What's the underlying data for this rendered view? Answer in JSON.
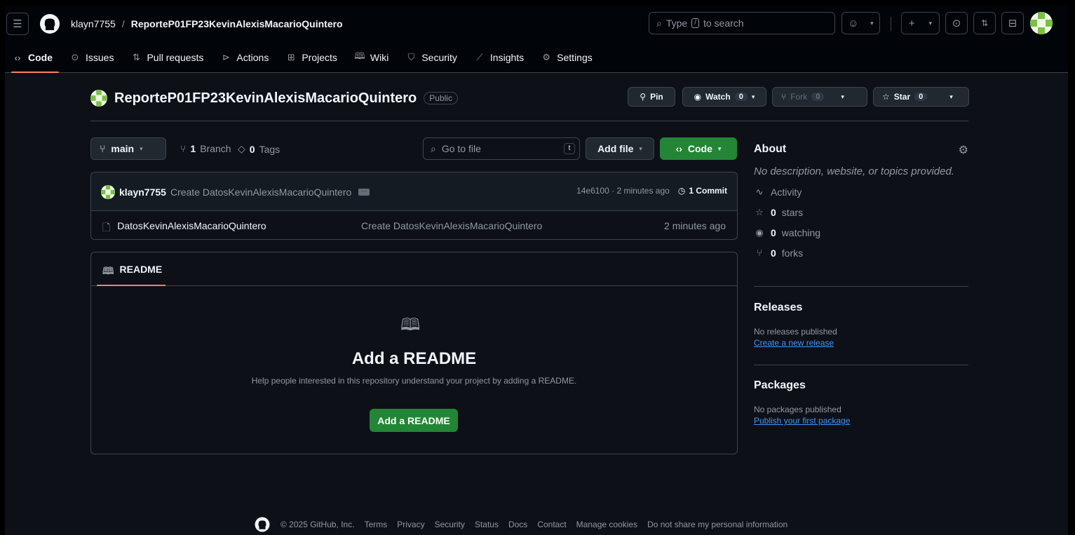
{
  "header": {
    "owner": "klayn7755",
    "separator": "/",
    "repo": "ReporteP01FP23KevinAlexisMacarioQuintero",
    "search": {
      "prefix": "Type",
      "key": "/",
      "suffix": "to search"
    }
  },
  "tabs": [
    {
      "label": "Code",
      "icon": "code-icon"
    },
    {
      "label": "Issues",
      "icon": "issue-icon"
    },
    {
      "label": "Pull requests",
      "icon": "pull-request-icon"
    },
    {
      "label": "Actions",
      "icon": "play-icon"
    },
    {
      "label": "Projects",
      "icon": "table-icon"
    },
    {
      "label": "Wiki",
      "icon": "book-icon"
    },
    {
      "label": "Security",
      "icon": "shield-icon"
    },
    {
      "label": "Insights",
      "icon": "graph-icon"
    },
    {
      "label": "Settings",
      "icon": "gear-icon"
    }
  ],
  "repo_header": {
    "name": "ReporteP01FP23KevinAlexisMacarioQuintero",
    "visibility": "Public",
    "pin": "Pin",
    "watch": {
      "label": "Watch",
      "count": "0"
    },
    "fork": {
      "label": "Fork",
      "count": "0"
    },
    "star": {
      "label": "Star",
      "count": "0"
    }
  },
  "toolbar": {
    "branch": "main",
    "branches_count": "1",
    "branches_label": "Branch",
    "tags_count": "0",
    "tags_label": "Tags",
    "goto_placeholder": "Go to file",
    "goto_key": "t",
    "add_file": "Add file",
    "code": "Code"
  },
  "commit": {
    "author": "klayn7755",
    "message": "Create DatosKevinAlexisMacarioQuintero",
    "hash_time": "14e6100 · 2 minutes ago",
    "commits": "1 Commit"
  },
  "files": [
    {
      "name": "DatosKevinAlexisMacarioQuintero",
      "commit": "Create DatosKevinAlexisMacarioQuintero",
      "time": "2 minutes ago"
    }
  ],
  "readme": {
    "tab": "README",
    "title": "Add a README",
    "help": "Help people interested in this repository understand your project by adding a README.",
    "button": "Add a README"
  },
  "about": {
    "title": "About",
    "description": "No description, website, or topics provided.",
    "activity": "Activity",
    "stars_count": "0",
    "stars_label": "stars",
    "watching_count": "0",
    "watching_label": "watching",
    "forks_count": "0",
    "forks_label": "forks"
  },
  "releases": {
    "title": "Releases",
    "none": "No releases published",
    "link": "Create a new release"
  },
  "packages": {
    "title": "Packages",
    "none": "No packages published",
    "link": "Publish your first package"
  },
  "footer": {
    "copyright": "© 2025 GitHub, Inc.",
    "links": [
      "Terms",
      "Privacy",
      "Security",
      "Status",
      "Docs",
      "Contact",
      "Manage cookies",
      "Do not share my personal information"
    ]
  },
  "colors": {
    "accent_green": "#238636",
    "link_blue": "#4493f8",
    "tab_underline": "#f78166",
    "bg": "#0d1117"
  }
}
